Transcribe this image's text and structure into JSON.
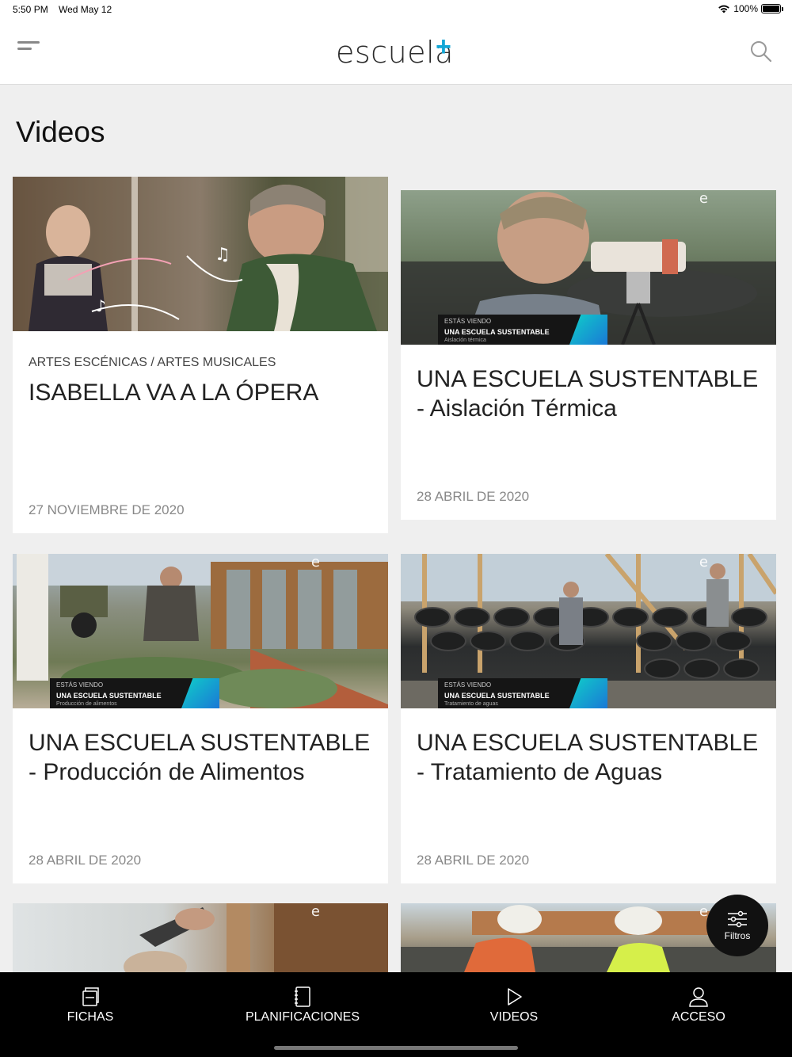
{
  "status_bar": {
    "time": "5:50 PM",
    "date": "Wed May 12",
    "battery": "100%"
  },
  "header": {
    "logo_text": "escuela",
    "logo_plus": "+"
  },
  "page": {
    "title": "Videos"
  },
  "cards": [
    {
      "category": "ARTES ESCÉNICAS / ARTES MUSICALES",
      "title": "ISABELLA VA A LA ÓPERA",
      "date": "27 NOVIEMBRE DE 2020"
    },
    {
      "title": "UNA ESCUELA SUSTENTABLE - Aislación Térmica",
      "date": "28 ABRIL DE 2020",
      "overlay": {
        "line1": "ESTÁS VIENDO",
        "line2": "UNA ESCUELA SUSTENTABLE",
        "line3": "Aislación térmica"
      }
    },
    {
      "title": "UNA ESCUELA SUSTENTABLE - Producción de Alimentos",
      "date": "28 ABRIL DE 2020",
      "overlay": {
        "line1": "ESTÁS VIENDO",
        "line2": "UNA ESCUELA SUSTENTABLE",
        "line3": "Producción de alimentos"
      }
    },
    {
      "title": "UNA ESCUELA SUSTENTABLE - Tratamiento de Aguas",
      "date": "28 ABRIL DE 2020",
      "overlay": {
        "line1": "ESTÁS VIENDO",
        "line2": "UNA ESCUELA SUSTENTABLE",
        "line3": "Tratamiento de aguas"
      }
    }
  ],
  "fab": {
    "label": "Filtros",
    "icon": "sliders-icon"
  },
  "tabs": [
    {
      "label": "FICHAS",
      "icon": "cards-icon"
    },
    {
      "label": "PLANIFICACIONES",
      "icon": "notebook-icon"
    },
    {
      "label": "VIDEOS",
      "icon": "play-icon"
    },
    {
      "label": "ACCESO",
      "icon": "user-icon"
    }
  ],
  "colors": {
    "accent": "#14a7d6",
    "tabbar_bg": "#000000",
    "page_bg": "#efefef"
  }
}
